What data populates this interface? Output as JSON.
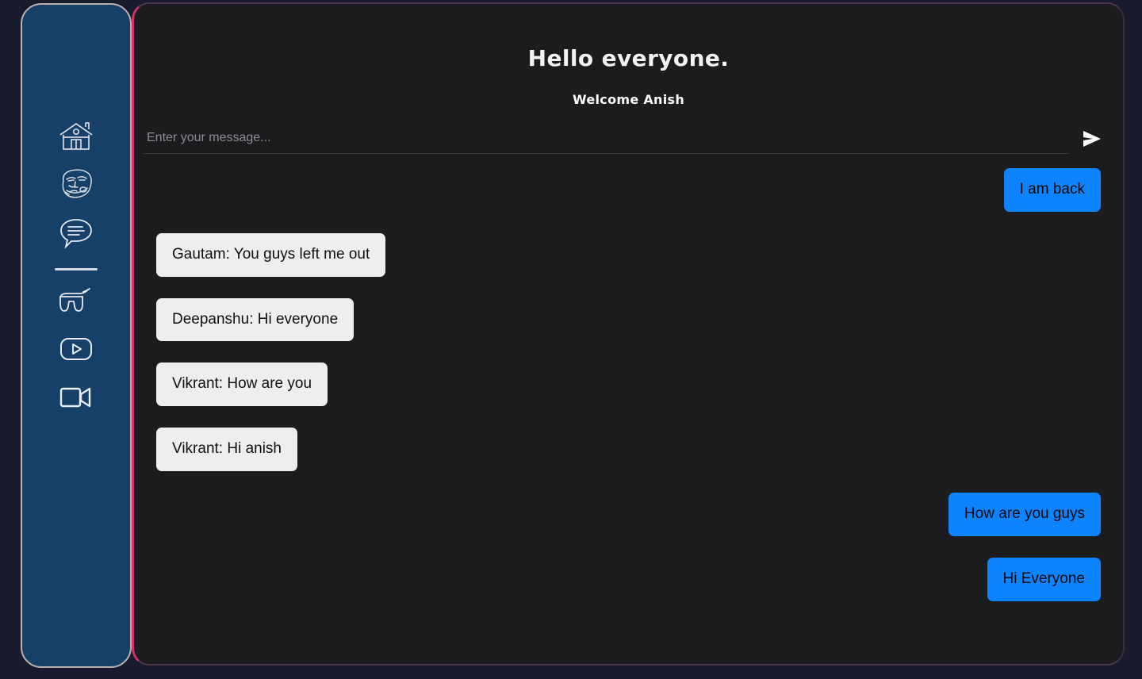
{
  "app": {
    "background_color": "#191a2b",
    "panel_color": "#1c1c1e",
    "sidebar_color": "#164067",
    "sidebar_border_color": "#b9b2ae",
    "panel_accent_border_color": "#d6336c",
    "outgoing_bubble_color": "#0d84fe",
    "incoming_bubble_color": "#eeeeee"
  },
  "sidebar": {
    "items": [
      {
        "icon": "home-icon",
        "name": "sidebar-item-home"
      },
      {
        "icon": "meme-face-icon",
        "name": "sidebar-item-memes"
      },
      {
        "icon": "chat-bubble-icon",
        "name": "sidebar-item-chat"
      },
      {
        "icon": "game-controller-icon",
        "name": "sidebar-item-games"
      },
      {
        "icon": "youtube-play-icon",
        "name": "sidebar-item-videos"
      },
      {
        "icon": "video-camera-icon",
        "name": "sidebar-item-video-call"
      }
    ]
  },
  "chat": {
    "title": "Hello everyone.",
    "subtitle": "Welcome Anish",
    "composer": {
      "placeholder": "Enter your message...",
      "value": "",
      "send_icon": "send-arrow-icon"
    },
    "messages": [
      {
        "direction": "out",
        "text": "I am back"
      },
      {
        "direction": "in",
        "text": "Gautam: You guys left me out"
      },
      {
        "direction": "in",
        "text": "Deepanshu: Hi everyone"
      },
      {
        "direction": "in",
        "text": "Vikrant: How are you"
      },
      {
        "direction": "in",
        "text": "Vikrant: Hi anish"
      },
      {
        "direction": "out",
        "text": "How are you guys"
      },
      {
        "direction": "out",
        "text": "Hi Everyone"
      }
    ]
  }
}
